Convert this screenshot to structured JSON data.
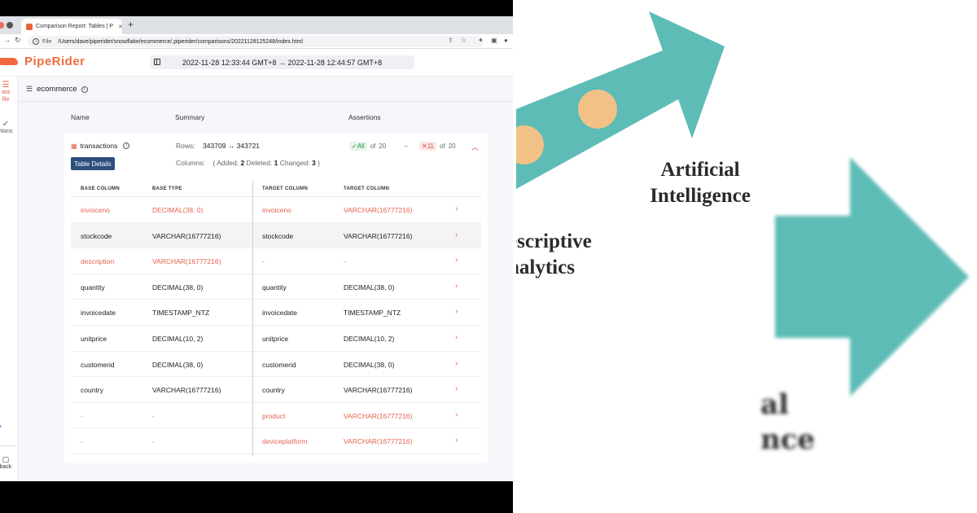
{
  "browser": {
    "tab_title": "Comparison Report: Tables | P",
    "url_prefix": "File",
    "url": "/Users/dave/piperider/snowflake/ecommerce/.piperider/comparisons/20221128125248/index.html"
  },
  "app": {
    "logo": "PipeRider",
    "date_range": "2022-11-28 12:33:44 GMT+8 → 2022-11-28 12:44:57 GMT+8",
    "nav": {
      "profile_label_1": "ata",
      "profile_label_2": "file",
      "assertions_label": "rtions",
      "feedback_label": "back"
    },
    "breadcrumb": "ecommerce",
    "columns": {
      "name": "Name",
      "summary": "Summary",
      "assertions": "Assertions"
    },
    "table": {
      "name": "transactions",
      "details_button": "Table Details",
      "rows_label": "Rows:",
      "rows_value": "343709 → 343721",
      "columns_label": "Columns:",
      "added_label": "Added:",
      "added_value": "2",
      "deleted_label": "Deleted:",
      "deleted_value": "1",
      "changed_label": "Changed:",
      "changed_value": "3",
      "paren_open": "(",
      "paren_close": ")",
      "assert_ok": "✓All",
      "assert_of": "of",
      "assert_total": "20",
      "assert_arrow": "→",
      "assert_fail": "✕11",
      "assert_fail_of": "of",
      "assert_fail_total": "20"
    },
    "compare": {
      "headers": [
        "BASE COLUMN",
        "BASE TYPE",
        "TARGET COLUMN",
        "TARGET COLUMN"
      ],
      "rows": [
        {
          "base_col": "invoiceno",
          "base_type": "DECIMAL(38, 0)",
          "target_col": "invoiceno",
          "target_type": "VARCHAR(16777216)",
          "changed": true
        },
        {
          "base_col": "stockcode",
          "base_type": "VARCHAR(16777216)",
          "target_col": "stockcode",
          "target_type": "VARCHAR(16777216)",
          "changed": false
        },
        {
          "base_col": "description",
          "base_type": "VARCHAR(16777216)",
          "target_col": "-",
          "target_type": "-",
          "changed": true
        },
        {
          "base_col": "quantity",
          "base_type": "DECIMAL(38, 0)",
          "target_col": "quantity",
          "target_type": "DECIMAL(38, 0)",
          "changed": false
        },
        {
          "base_col": "invoicedate",
          "base_type": "TIMESTAMP_NTZ",
          "target_col": "invoicedate",
          "target_type": "TIMESTAMP_NTZ",
          "changed": false
        },
        {
          "base_col": "unitprice",
          "base_type": "DECIMAL(10, 2)",
          "target_col": "unitprice",
          "target_type": "DECIMAL(10, 2)",
          "changed": false
        },
        {
          "base_col": "customerid",
          "base_type": "DECIMAL(38, 0)",
          "target_col": "customerid",
          "target_type": "DECIMAL(38, 0)",
          "changed": false
        },
        {
          "base_col": "country",
          "base_type": "VARCHAR(16777216)",
          "target_col": "country",
          "target_type": "VARCHAR(16777216)",
          "changed": false
        },
        {
          "base_col": "-",
          "base_type": "-",
          "target_col": "product",
          "target_type": "VARCHAR(16777216)",
          "changed": true
        },
        {
          "base_col": "-",
          "base_type": "-",
          "target_col": "deviceplatform",
          "target_type": "VARCHAR(16777216)",
          "changed": true
        }
      ]
    }
  },
  "art": {
    "ai_line1": "Artificial",
    "ai_line2": "Intelligence",
    "da_line1": "escriptive",
    "da_line2": "nalytics",
    "blur_line1": "al",
    "blur_line2": "nce",
    "colors": {
      "teal": "#5dbcb6",
      "orange": "#f2c188"
    }
  }
}
